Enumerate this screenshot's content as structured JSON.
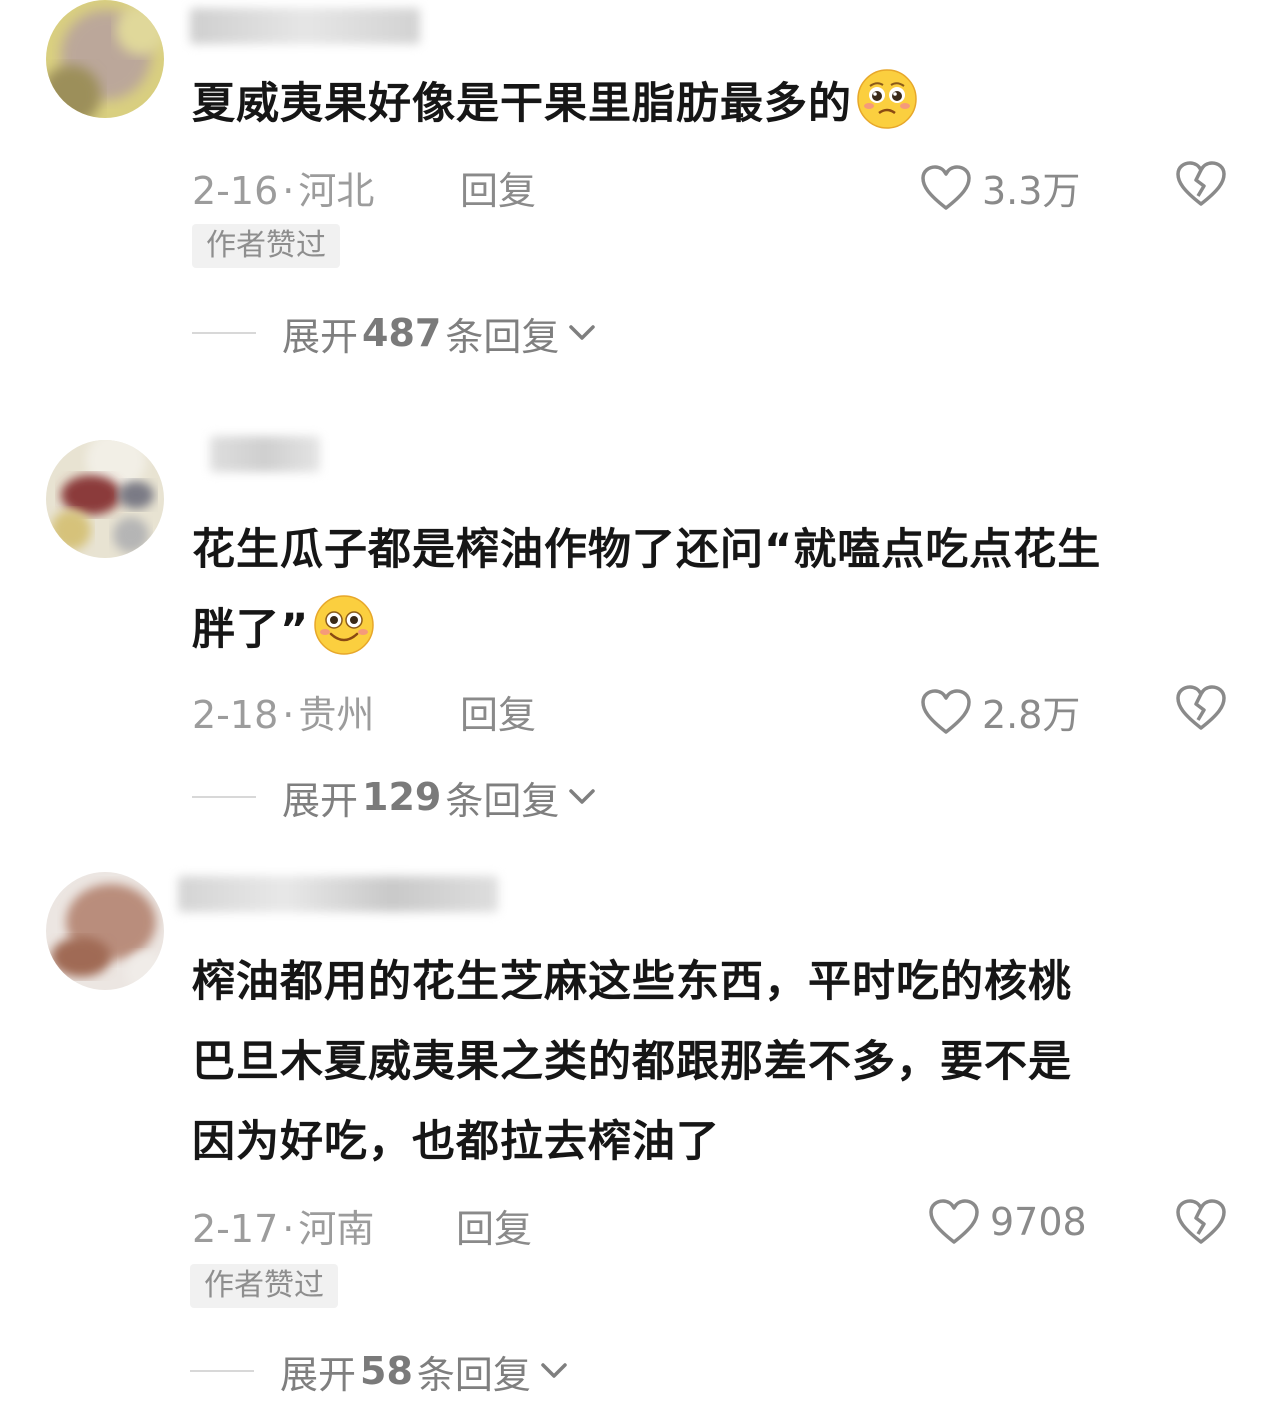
{
  "comments": [
    {
      "text": "夏威夷果好像是干果里脂肪最多的",
      "emoji": "pleading-face-emoji",
      "date": "2-16",
      "location": "河北",
      "reply_label": "回复",
      "likes": "3.3万",
      "badge": "作者赞过",
      "expand": {
        "prefix": "展开",
        "count": "487",
        "suffix": "条回复"
      }
    },
    {
      "text_line1": "花生瓜子都是榨油作物了还问“就嗑点吃点花生",
      "text_line2": "胖了”",
      "emoji": "smiling-face-emoji",
      "date": "2-18",
      "location": "贵州",
      "reply_label": "回复",
      "likes": "2.8万",
      "expand": {
        "prefix": "展开",
        "count": "129",
        "suffix": "条回复"
      }
    },
    {
      "text_line1": "榨油都用的花生芝麻这些东西，平时吃的核桃",
      "text_line2": "巴旦木夏威夷果之类的都跟那差不多，要不是",
      "text_line3": "因为好吃，也都拉去榨油了",
      "date": "2-17",
      "location": "河南",
      "reply_label": "回复",
      "likes": "9708",
      "badge": "作者赞过",
      "expand": {
        "prefix": "展开",
        "count": "58",
        "suffix": "条回复"
      }
    }
  ],
  "separator": "·",
  "icons": {
    "like": "heart-outline-icon",
    "dislike": "broken-heart-icon",
    "expand": "chevron-down-icon"
  },
  "colors": {
    "text": "#161616",
    "meta": "#9c9c9c",
    "badge_bg": "#f1f1f1"
  }
}
